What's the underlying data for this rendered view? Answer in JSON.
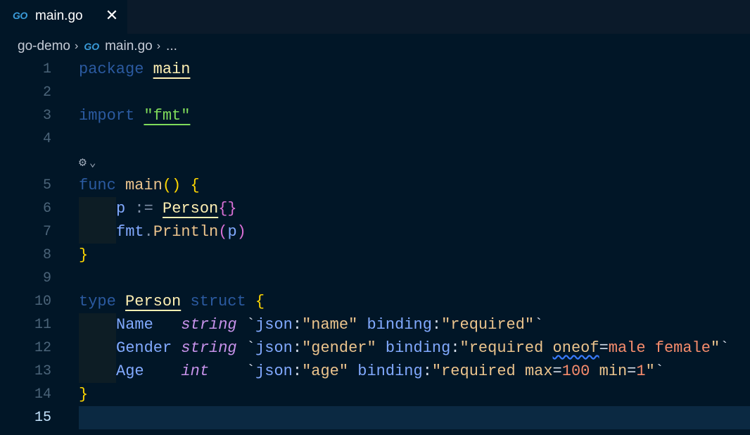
{
  "tab": {
    "logo": "GO",
    "label": "main.go",
    "close": "✕"
  },
  "breadcrumb": {
    "folder": "go-demo",
    "logo": "GO",
    "file": "main.go",
    "more": "..."
  },
  "editor": {
    "line_numbers": [
      "1",
      "2",
      "3",
      "4",
      "5",
      "6",
      "7",
      "8",
      "9",
      "10",
      "11",
      "12",
      "13",
      "14",
      "15"
    ],
    "codelens_icon": "gear-icon",
    "codelens_chevron": "⌄",
    "tokens": {
      "l1": [
        "package",
        " ",
        "main"
      ],
      "l3": [
        "import",
        " ",
        "\"fmt\""
      ],
      "l5": [
        "func",
        " ",
        "main",
        "()",
        " ",
        "{"
      ],
      "l6": [
        "p",
        " := ",
        "Person",
        "{}"
      ],
      "l7": [
        "fmt",
        ".",
        "Println",
        "(",
        "p",
        ")"
      ],
      "l8": [
        "}"
      ],
      "l10": [
        "type",
        " ",
        "Person",
        " ",
        "struct",
        " ",
        "{"
      ],
      "l11": [
        "Name",
        "   ",
        "string",
        " `",
        "json",
        ":",
        "\"name\"",
        " ",
        "binding",
        ":",
        "\"required\"",
        "`"
      ],
      "l12": [
        "Gender",
        " ",
        "string",
        " `",
        "json",
        ":",
        "\"gender\"",
        " ",
        "binding",
        ":",
        "\"required ",
        "oneof",
        "=",
        "male female",
        "\"",
        "`"
      ],
      "l13": [
        "Age",
        "    ",
        "int",
        "    `",
        "json",
        ":",
        "\"age\"",
        " ",
        "binding",
        ":",
        "\"required ",
        "max",
        "=",
        "100",
        " ",
        "min",
        "=",
        "1",
        "\"",
        "`"
      ],
      "l14": [
        "}"
      ]
    }
  }
}
